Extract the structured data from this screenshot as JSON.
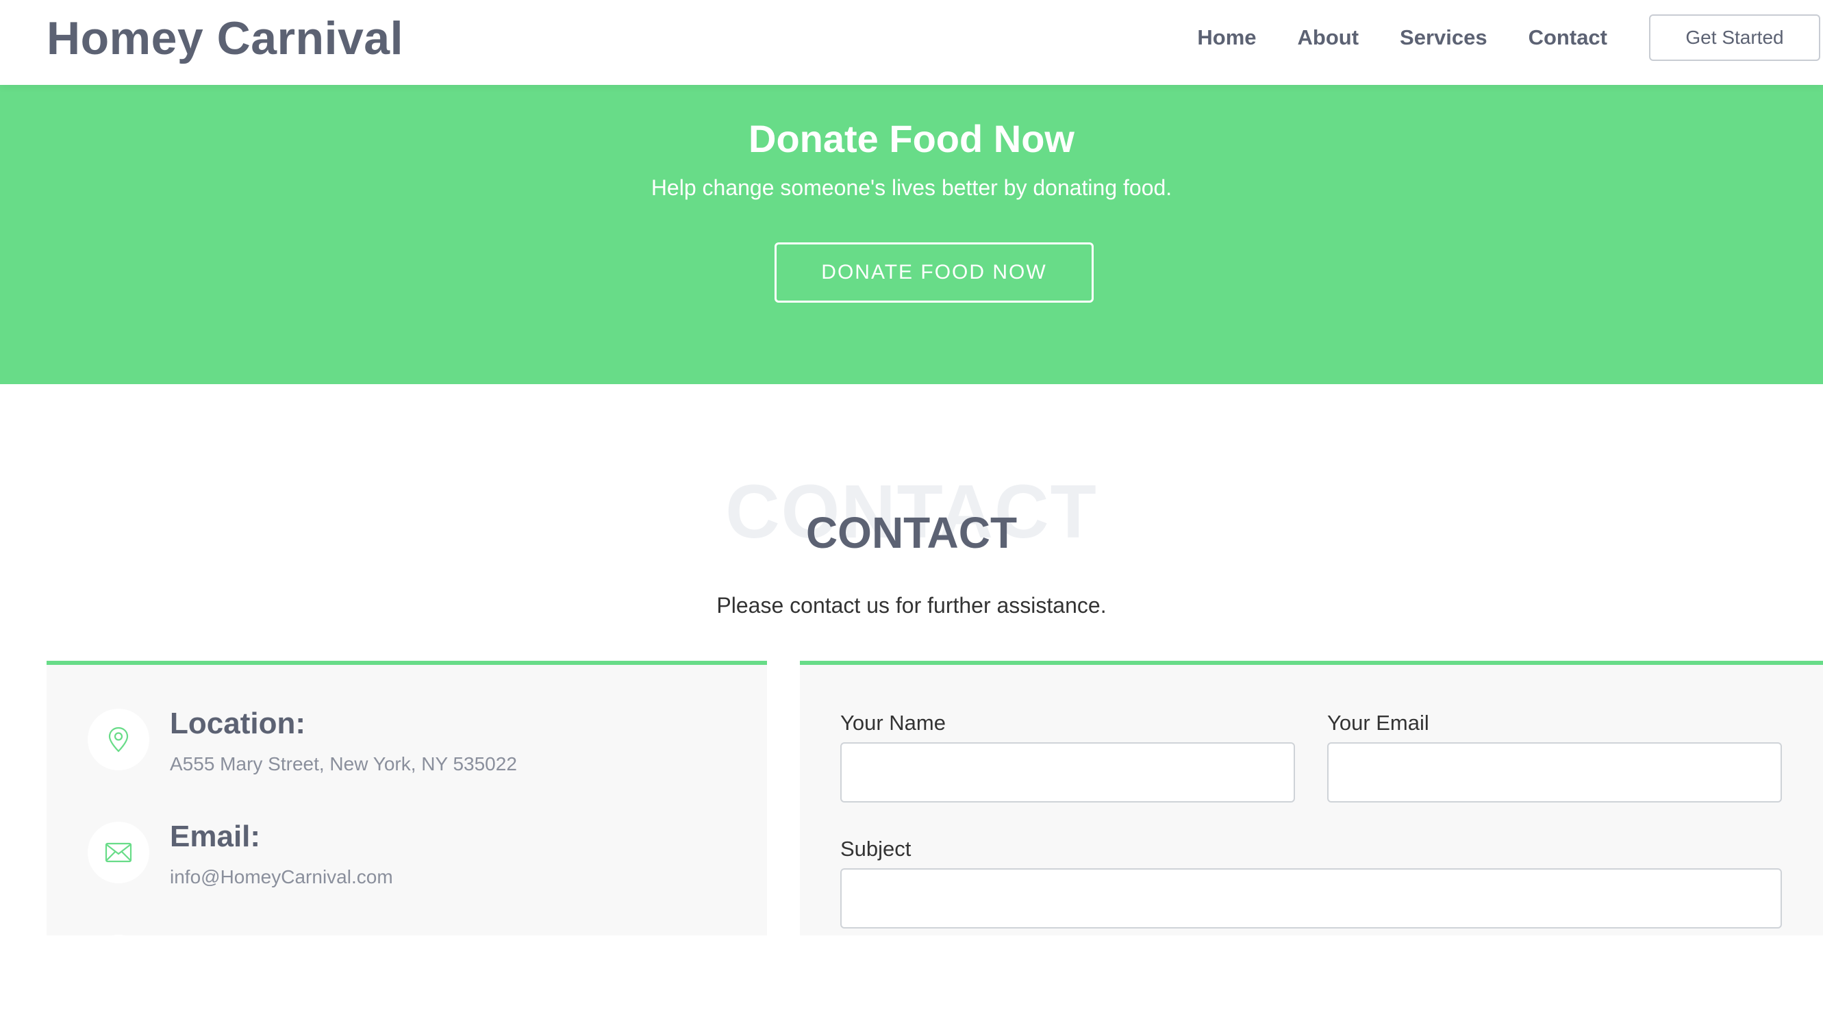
{
  "header": {
    "logo": "Homey Carnival",
    "nav": [
      "Home",
      "About",
      "Services",
      "Contact"
    ],
    "cta_label": "Get Started"
  },
  "hero": {
    "title": "Donate Food Now",
    "subtitle": "Help change someone's lives better by donating food.",
    "button_label": "DONATE FOOD NOW"
  },
  "contact": {
    "watermark": "CONTACT",
    "title": "CONTACT",
    "subtitle": "Please contact us for further assistance.",
    "info": {
      "location_label": "Location:",
      "location_value": "A555 Mary Street, New York, NY 535022",
      "email_label": "Email:",
      "email_value": "info@HomeyCarnival.com"
    },
    "form": {
      "name_label": "Your Name",
      "name_value": "",
      "email_label": "Your Email",
      "email_value": "",
      "subject_label": "Subject",
      "subject_value": ""
    }
  },
  "colors": {
    "accent": "#68dc88",
    "text_dark": "#5c6273",
    "card_bg": "#f8f8f8"
  },
  "icons": {
    "location": "map-pin-icon",
    "email": "envelope-icon",
    "phone": "phone-icon"
  }
}
